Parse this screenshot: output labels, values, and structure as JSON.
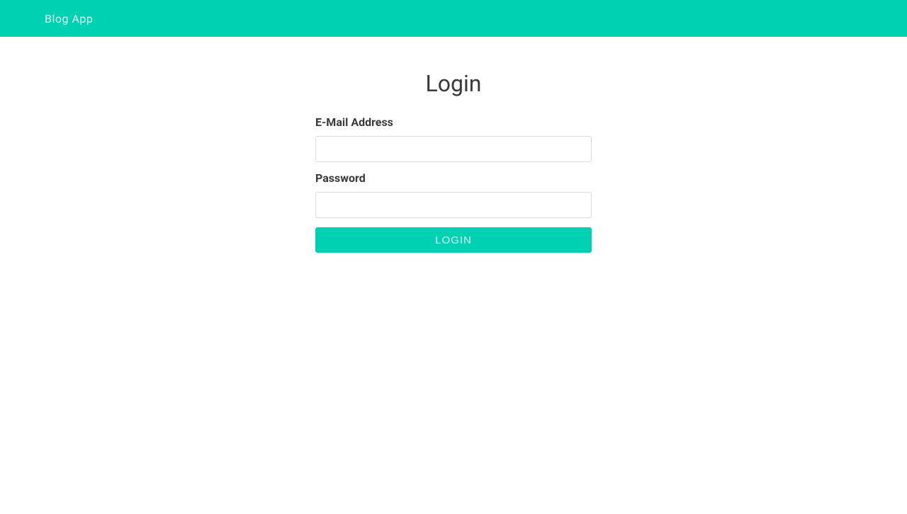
{
  "header": {
    "title": "Blog App"
  },
  "page": {
    "title": "Login"
  },
  "form": {
    "email": {
      "label": "E-Mail Address",
      "value": ""
    },
    "password": {
      "label": "Password",
      "value": ""
    },
    "submit": {
      "label": "LOGIN"
    }
  }
}
